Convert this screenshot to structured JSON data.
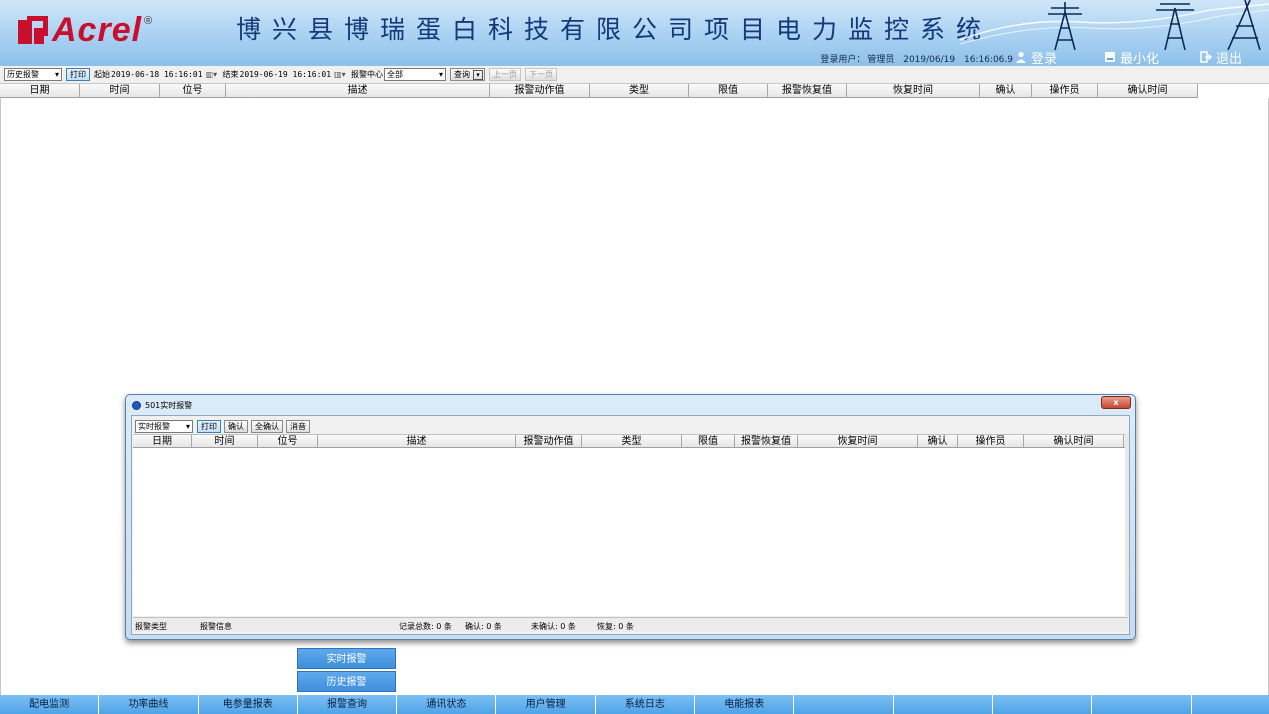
{
  "header": {
    "logo_text": "Acrel",
    "logo_reg": "®",
    "title": "博兴县博瑞蛋白科技有限公司项目电力监控系统",
    "user_label": "登录用户：",
    "user_name": "管理员",
    "date": "2019/06/19",
    "time": "16:16:06.9",
    "login_label": "登录",
    "minimize_label": "最小化",
    "exit_label": "退出"
  },
  "toolbar": {
    "mode_select": "历史报警",
    "print_label": "打印",
    "start_label": "起始",
    "start_value": "2019-06-18 16:16:01",
    "end_label": "结束",
    "end_value": "2019-06-19 16:16:01",
    "center_label": "报警中心",
    "center_select": "全部",
    "query_label": "查询",
    "prev_label": "上一页",
    "next_label": "下一页"
  },
  "main_table": {
    "columns": [
      "日期",
      "时间",
      "位号",
      "描述",
      "报警动作值",
      "类型",
      "限值",
      "报警恢复值",
      "恢复时间",
      "确认",
      "操作员",
      "确认时间"
    ]
  },
  "dialog": {
    "title": "501实时报警",
    "close_label": "x",
    "mode_select": "实时报警",
    "print_label": "打印",
    "confirm_label": "确认",
    "confirm_all_label": "全确认",
    "mute_label": "消音",
    "columns": [
      "日期",
      "时间",
      "位号",
      "描述",
      "报警动作值",
      "类型",
      "限值",
      "报警恢复值",
      "恢复时间",
      "确认",
      "操作员",
      "确认时间"
    ],
    "status": {
      "alarm_type": "报警类型",
      "alarm_info": "报警信息",
      "total": "记录总数: 0 条",
      "confirmed": "确认: 0 条",
      "unconfirmed": "未确认: 0 条",
      "recovered": "恢复: 0 条"
    }
  },
  "menu": {
    "realtime": "实时报警",
    "history": "历史报警"
  },
  "nav": [
    "配电监测",
    "功率曲线",
    "电参量报表",
    "报警查询",
    "通讯状态",
    "用户管理",
    "系统日志",
    "电能报表",
    "",
    "",
    "",
    "",
    ""
  ],
  "colors": {
    "brand_red": "#c8102e",
    "title_blue": "#14387a",
    "menu_blue": "#3f8fdc",
    "nav_blue": "#4ea3e8"
  }
}
